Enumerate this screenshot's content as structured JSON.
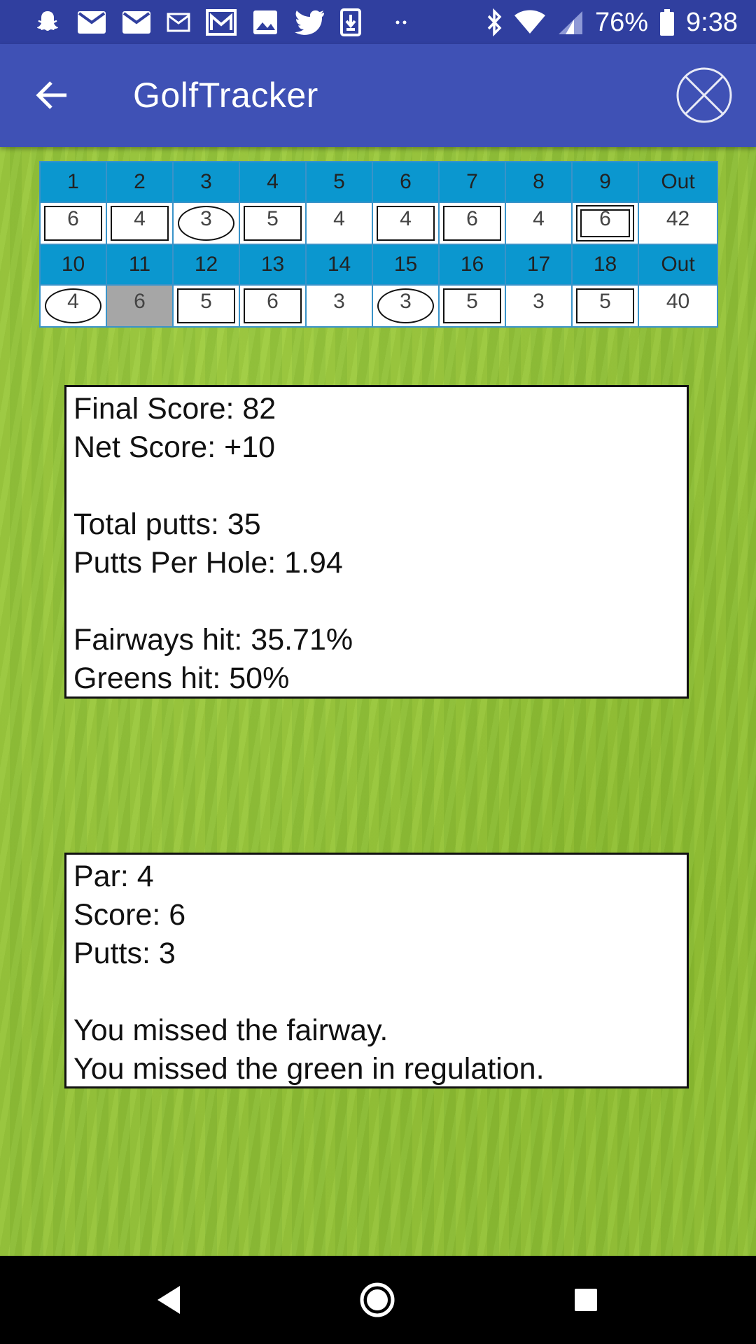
{
  "status_bar": {
    "battery_percent": "76%",
    "time": "9:38",
    "notification_icons": [
      "snapchat-icon",
      "email-icon",
      "email-icon",
      "email-outline-icon",
      "gmail-icon",
      "image-icon",
      "twitter-icon",
      "download-icon",
      "more-dots-icon"
    ],
    "system_icons": [
      "bluetooth-icon",
      "wifi-icon",
      "signal-icon",
      "battery-icon"
    ]
  },
  "app_bar": {
    "title": "GolfTracker",
    "back_icon": "arrow-back-icon",
    "close_icon": "close-circle-icon"
  },
  "scorecard": {
    "front": {
      "holes": [
        "1",
        "2",
        "3",
        "4",
        "5",
        "6",
        "7",
        "8",
        "9",
        "Out"
      ],
      "scores": [
        "6",
        "4",
        "3",
        "5",
        "4",
        "4",
        "6",
        "4",
        "6",
        "42"
      ],
      "marks": [
        "box",
        "box",
        "circle",
        "box",
        "none",
        "box",
        "box",
        "none",
        "double-box",
        "none"
      ]
    },
    "back": {
      "holes": [
        "10",
        "11",
        "12",
        "13",
        "14",
        "15",
        "16",
        "17",
        "18",
        "Out"
      ],
      "scores": [
        "4",
        "6",
        "5",
        "6",
        "3",
        "3",
        "5",
        "3",
        "5",
        "40"
      ],
      "marks": [
        "circle",
        "none",
        "box",
        "box",
        "none",
        "circle",
        "box",
        "none",
        "box",
        "none"
      ],
      "selected_hole": "11"
    }
  },
  "summary": {
    "final_score": "Final Score: 82",
    "net_score": "Net Score: +10",
    "total_putts": "Total putts: 35",
    "putts_per_hole": "Putts Per Hole: 1.94",
    "fairways_hit": "Fairways hit: 35.71%",
    "greens_hit": "Greens hit: 50%"
  },
  "hole_detail": {
    "par": "Par: 4",
    "score": "Score: 6",
    "putts": "Putts: 3",
    "fairway_msg": "You missed the fairway.",
    "green_msg": "You missed the green in regulation."
  },
  "nav_bar": {
    "back": "nav-back-icon",
    "home": "nav-home-icon",
    "recents": "nav-recents-icon"
  },
  "colors": {
    "status_bar": "#303f9f",
    "app_bar": "#3f51b5",
    "hole_header": "#0b97cf",
    "grass": "#93c238",
    "selected_cell": "#a6a6a6"
  }
}
